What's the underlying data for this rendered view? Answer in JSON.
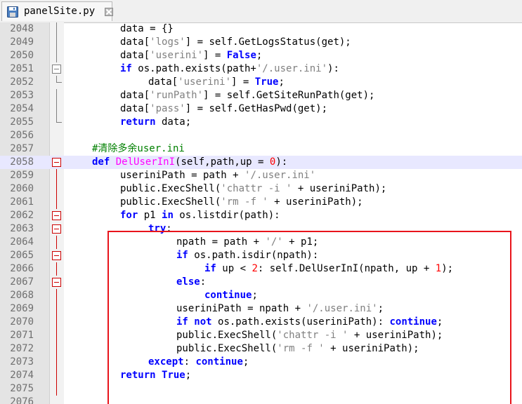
{
  "tab": {
    "label": "panelSite.py",
    "save_icon": "floppy-disk-icon",
    "close_icon": "close-icon"
  },
  "colors": {
    "keyword": "#0000ff",
    "string": "#808080",
    "number": "#ff0000",
    "comment": "#008000",
    "function_name": "#ff00ff",
    "annotation_box": "#e8141b"
  },
  "editor": {
    "current_line": 2058,
    "lines": [
      {
        "n": "2048",
        "ind": 4,
        "fold": "line",
        "tok": [
          [
            "t",
            "data = {}"
          ]
        ]
      },
      {
        "n": "2049",
        "ind": 4,
        "fold": "line",
        "tok": [
          [
            "t",
            "data["
          ],
          [
            "s",
            "'logs'"
          ],
          [
            "t",
            "] = self.GetLogsStatus(get);"
          ]
        ]
      },
      {
        "n": "2050",
        "ind": 4,
        "fold": "line",
        "tok": [
          [
            "t",
            "data["
          ],
          [
            "s",
            "'userini'"
          ],
          [
            "t",
            "] = "
          ],
          [
            "k",
            "False"
          ],
          [
            "t",
            ";"
          ]
        ]
      },
      {
        "n": "2051",
        "ind": 4,
        "fold": "box",
        "tok": [
          [
            "k",
            "if"
          ],
          [
            "t",
            " os.path.exists(path+"
          ],
          [
            "s",
            "'/.user.ini'"
          ],
          [
            "t",
            "):"
          ]
        ]
      },
      {
        "n": "2052",
        "ind": 5,
        "fold": "end",
        "tok": [
          [
            "t",
            "data["
          ],
          [
            "s",
            "'userini'"
          ],
          [
            "t",
            "] = "
          ],
          [
            "k",
            "True"
          ],
          [
            "t",
            ";"
          ]
        ]
      },
      {
        "n": "2053",
        "ind": 4,
        "fold": "line",
        "tok": [
          [
            "t",
            "data["
          ],
          [
            "s",
            "'runPath'"
          ],
          [
            "t",
            "] = self.GetSiteRunPath(get);"
          ]
        ]
      },
      {
        "n": "2054",
        "ind": 4,
        "fold": "line",
        "tok": [
          [
            "t",
            "data["
          ],
          [
            "s",
            "'pass'"
          ],
          [
            "t",
            "] = self.GetHasPwd(get);"
          ]
        ]
      },
      {
        "n": "2055",
        "ind": 4,
        "fold": "end",
        "tok": [
          [
            "k",
            "return"
          ],
          [
            "t",
            " data;"
          ]
        ]
      },
      {
        "n": "2056",
        "ind": 0,
        "fold": "none",
        "tok": []
      },
      {
        "n": "2057",
        "ind": 3,
        "fold": "none",
        "tok": [
          [
            "c",
            "#清除多余user.ini"
          ]
        ]
      },
      {
        "n": "2058",
        "ind": 3,
        "fold": "redbox",
        "tok": [
          [
            "k",
            "def"
          ],
          [
            "t",
            " "
          ],
          [
            "f",
            "DelUserInI"
          ],
          [
            "t",
            "(self,path,up = "
          ],
          [
            "n",
            "0"
          ],
          [
            "t",
            "):"
          ]
        ]
      },
      {
        "n": "2059",
        "ind": 4,
        "fold": "redline",
        "tok": [
          [
            "t",
            "useriniPath = path + "
          ],
          [
            "s",
            "'/.user.ini'"
          ]
        ]
      },
      {
        "n": "2060",
        "ind": 4,
        "fold": "redline",
        "tok": [
          [
            "t",
            "public.ExecShell("
          ],
          [
            "s",
            "'chattr -i '"
          ],
          [
            "t",
            " + useriniPath);"
          ]
        ]
      },
      {
        "n": "2061",
        "ind": 4,
        "fold": "redline",
        "tok": [
          [
            "t",
            "public.ExecShell("
          ],
          [
            "s",
            "'rm -f '"
          ],
          [
            "t",
            " + useriniPath);"
          ]
        ]
      },
      {
        "n": "2062",
        "ind": 4,
        "fold": "redbox",
        "tok": [
          [
            "k",
            "for"
          ],
          [
            "t",
            " p1 "
          ],
          [
            "k",
            "in"
          ],
          [
            "t",
            " os.listdir(path):"
          ]
        ]
      },
      {
        "n": "2063",
        "ind": 5,
        "fold": "redbox",
        "tok": [
          [
            "k",
            "try"
          ],
          [
            "t",
            ":"
          ]
        ]
      },
      {
        "n": "2064",
        "ind": 6,
        "fold": "redline",
        "tok": [
          [
            "t",
            "npath = path + "
          ],
          [
            "s",
            "'/'"
          ],
          [
            "t",
            " + p1;"
          ]
        ]
      },
      {
        "n": "2065",
        "ind": 6,
        "fold": "redbox",
        "tok": [
          [
            "k",
            "if"
          ],
          [
            "t",
            " os.path.isdir(npath):"
          ]
        ]
      },
      {
        "n": "2066",
        "ind": 7,
        "fold": "redline",
        "tok": [
          [
            "k",
            "if"
          ],
          [
            "t",
            " up < "
          ],
          [
            "n",
            "2"
          ],
          [
            "t",
            ": self.DelUserInI(npath, up + "
          ],
          [
            "n",
            "1"
          ],
          [
            "t",
            ");"
          ]
        ]
      },
      {
        "n": "2067",
        "ind": 6,
        "fold": "redbox",
        "tok": [
          [
            "k",
            "else"
          ],
          [
            "t",
            ":"
          ]
        ]
      },
      {
        "n": "2068",
        "ind": 7,
        "fold": "redline",
        "tok": [
          [
            "k",
            "continue"
          ],
          [
            "t",
            ";"
          ]
        ]
      },
      {
        "n": "2069",
        "ind": 6,
        "fold": "redline",
        "tok": [
          [
            "t",
            "useriniPath = npath + "
          ],
          [
            "s",
            "'/.user.ini'"
          ],
          [
            "t",
            ";"
          ]
        ]
      },
      {
        "n": "2070",
        "ind": 6,
        "fold": "redline",
        "tok": [
          [
            "k",
            "if"
          ],
          [
            "t",
            " "
          ],
          [
            "k",
            "not"
          ],
          [
            "t",
            " os.path.exists(useriniPath): "
          ],
          [
            "k",
            "continue"
          ],
          [
            "t",
            ";"
          ]
        ]
      },
      {
        "n": "2071",
        "ind": 6,
        "fold": "redline",
        "tok": [
          [
            "t",
            "public.ExecShell("
          ],
          [
            "s",
            "'chattr -i '"
          ],
          [
            "t",
            " + useriniPath);"
          ]
        ]
      },
      {
        "n": "2072",
        "ind": 6,
        "fold": "redline",
        "tok": [
          [
            "t",
            "public.ExecShell("
          ],
          [
            "s",
            "'rm -f '"
          ],
          [
            "t",
            " + useriniPath);"
          ]
        ]
      },
      {
        "n": "2073",
        "ind": 5,
        "fold": "redline",
        "tok": [
          [
            "k",
            "except"
          ],
          [
            "t",
            ": "
          ],
          [
            "k",
            "continue"
          ],
          [
            "t",
            ";"
          ]
        ]
      },
      {
        "n": "2074",
        "ind": 4,
        "fold": "redline",
        "tok": [
          [
            "k",
            "return"
          ],
          [
            "t",
            " "
          ],
          [
            "k",
            "True"
          ],
          [
            "t",
            ";"
          ]
        ]
      },
      {
        "n": "2075",
        "ind": 0,
        "fold": "redline",
        "tok": []
      },
      {
        "n": "2076",
        "ind": 0,
        "fold": "none",
        "tok": []
      }
    ]
  }
}
